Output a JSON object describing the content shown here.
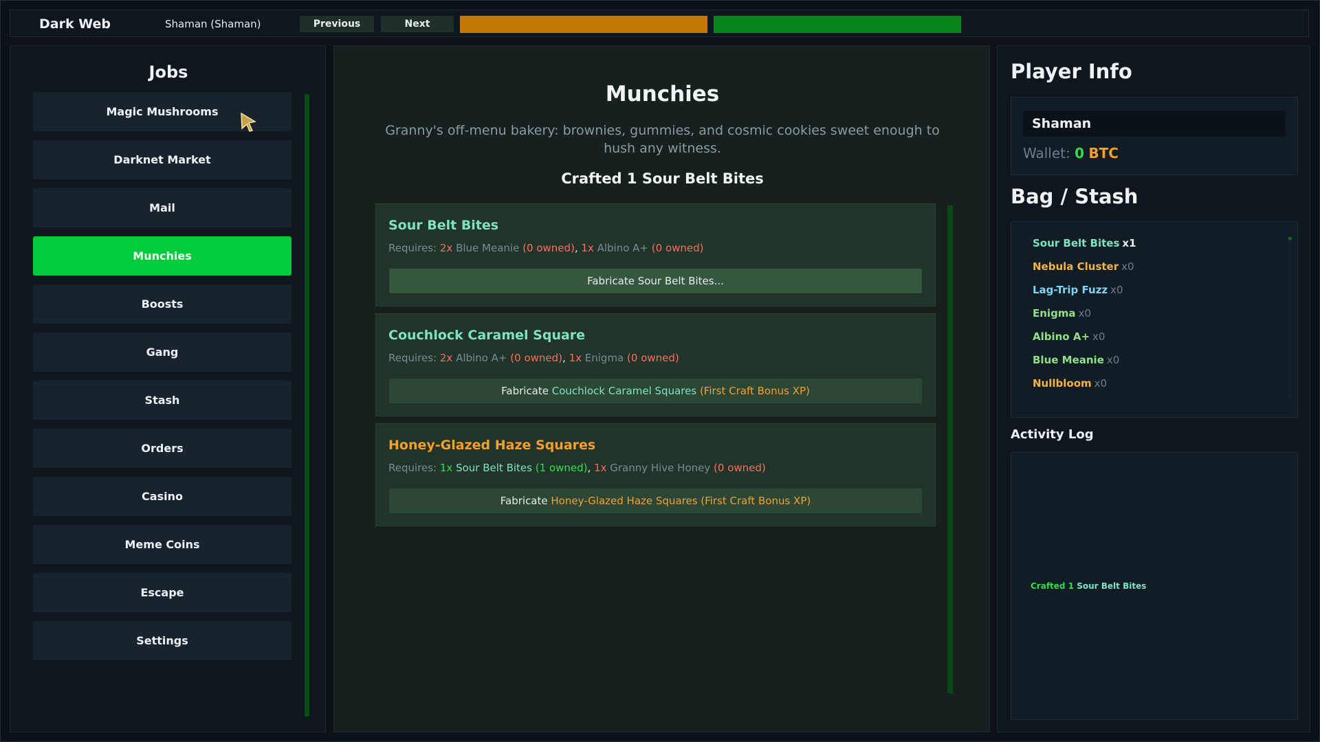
{
  "header": {
    "app_title": "Dark Web",
    "player_label": "Shaman (Shaman)",
    "previous_label": "Previous",
    "next_label": "Next",
    "orange_bar_fraction": 1.0,
    "green_bar_fraction": 1.0,
    "orange_color": "#c57708",
    "green_color": "#09841d"
  },
  "jobs": {
    "title": "Jobs",
    "items": [
      {
        "label": "Magic Mushrooms"
      },
      {
        "label": "Darknet Market"
      },
      {
        "label": "Mail"
      },
      {
        "label": "Munchies",
        "active": true
      },
      {
        "label": "Boosts"
      },
      {
        "label": "Gang"
      },
      {
        "label": "Stash"
      },
      {
        "label": "Orders"
      },
      {
        "label": "Casino"
      },
      {
        "label": "Meme Coins"
      },
      {
        "label": "Escape"
      },
      {
        "label": "Settings"
      }
    ]
  },
  "main": {
    "title": "Munchies",
    "description": "Granny's off-menu bakery: brownies, gummies, and cosmic cookies sweet enough to hush any witness.",
    "status": "Crafted 1 Sour Belt Bites",
    "recipes": [
      {
        "name": "Sour Belt Bites",
        "requires_label": "Requires:",
        "ingredients": [
          {
            "qty": "2x",
            "name": "Blue Meanie",
            "owned": "(0 owned)",
            "sep": ","
          },
          {
            "qty": "1x",
            "name": "Albino A+",
            "owned": "(0 owned)",
            "sep": ""
          }
        ],
        "button_prefix": "Fabricate Sour Belt Bites...",
        "button_item": "",
        "button_bonus": ""
      },
      {
        "name": "Couchlock Caramel Square",
        "requires_label": "Requires:",
        "ingredients": [
          {
            "qty": "2x",
            "name": "Albino A+",
            "owned": "(0 owned)",
            "sep": ","
          },
          {
            "qty": "1x",
            "name": "Enigma",
            "owned": "(0 owned)",
            "sep": ""
          }
        ],
        "button_prefix": "Fabricate",
        "button_item": "Couchlock Caramel Squares",
        "button_bonus": "(First Craft Bonus XP)"
      },
      {
        "name": "Honey-Glazed Haze Squares",
        "requires_label": "Requires:",
        "ingredients": [
          {
            "qty": "1x",
            "name": "Sour Belt Bites",
            "owned": "(1 owned)",
            "sep": ","
          },
          {
            "qty": "1x",
            "name": "Granny Hive Honey",
            "owned": "(0 owned)",
            "sep": ""
          }
        ],
        "button_prefix": "Fabricate",
        "button_item": "Honey-Glazed Haze Squares",
        "button_bonus": "(First Craft Bonus XP)"
      }
    ]
  },
  "player": {
    "title": "Player Info",
    "name": "Shaman",
    "wallet_label": "Wallet:",
    "wallet_amount": "0",
    "wallet_currency": "BTC"
  },
  "bag": {
    "title": "Bag / Stash",
    "items": [
      {
        "name": "Sour Belt Bites",
        "qty": "x1",
        "color": "#7fe3c2"
      },
      {
        "name": "Nebula Cluster",
        "qty": "x0",
        "color": "#f5b14a"
      },
      {
        "name": "Lag-Trip Fuzz",
        "qty": "x0",
        "color": "#7fd3f5"
      },
      {
        "name": "Enigma",
        "qty": "x0",
        "color": "#8fe08a"
      },
      {
        "name": "Albino A+",
        "qty": "x0",
        "color": "#8fe08a"
      },
      {
        "name": "Blue Meanie",
        "qty": "x0",
        "color": "#8fe08a"
      },
      {
        "name": "Nullbloom",
        "qty": "x0",
        "color": "#f5b14a"
      }
    ]
  },
  "log": {
    "title": "Activity Log",
    "entries": [
      {
        "prefix": "Crafted 1",
        "item": "Sour Belt Bites"
      }
    ]
  },
  "colors": {
    "accent_green": "#03cc3c",
    "mint": "#7fe3c2",
    "orange": "#f59f2e",
    "red": "#ff6b61"
  }
}
